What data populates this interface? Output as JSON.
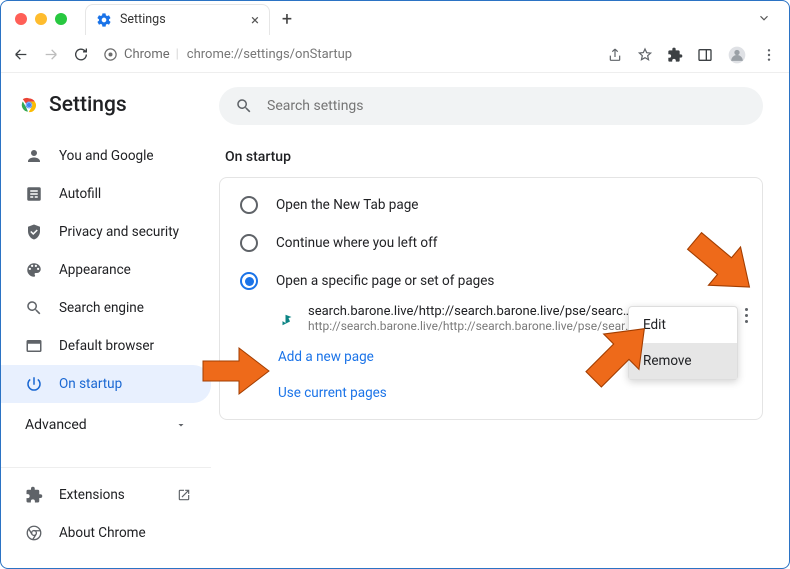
{
  "window": {
    "tab_title": "Settings",
    "url_badge": "Chrome",
    "url_path": "chrome://settings/onStartup"
  },
  "brand_title": "Settings",
  "search": {
    "placeholder": "Search settings"
  },
  "sidebar": {
    "items": [
      {
        "label": "You and Google"
      },
      {
        "label": "Autofill"
      },
      {
        "label": "Privacy and security"
      },
      {
        "label": "Appearance"
      },
      {
        "label": "Search engine"
      },
      {
        "label": "Default browser"
      },
      {
        "label": "On startup"
      }
    ],
    "advanced_label": "Advanced",
    "lower": [
      {
        "label": "Extensions"
      },
      {
        "label": "About Chrome"
      }
    ]
  },
  "section": {
    "title": "On startup",
    "radios": [
      {
        "label": "Open the New Tab page",
        "selected": false
      },
      {
        "label": "Continue where you left off",
        "selected": false
      },
      {
        "label": "Open a specific page or set of pages",
        "selected": true
      }
    ],
    "page": {
      "title": "search.barone.live/http://search.barone.live/pse/search?&query=%s&",
      "url": "http://search.barone.live/http://search.barone.live/pse/search?&quer…"
    },
    "add_label": "Add a new page",
    "use_current_label": "Use current pages"
  },
  "menu": {
    "edit": "Edit",
    "remove": "Remove"
  }
}
